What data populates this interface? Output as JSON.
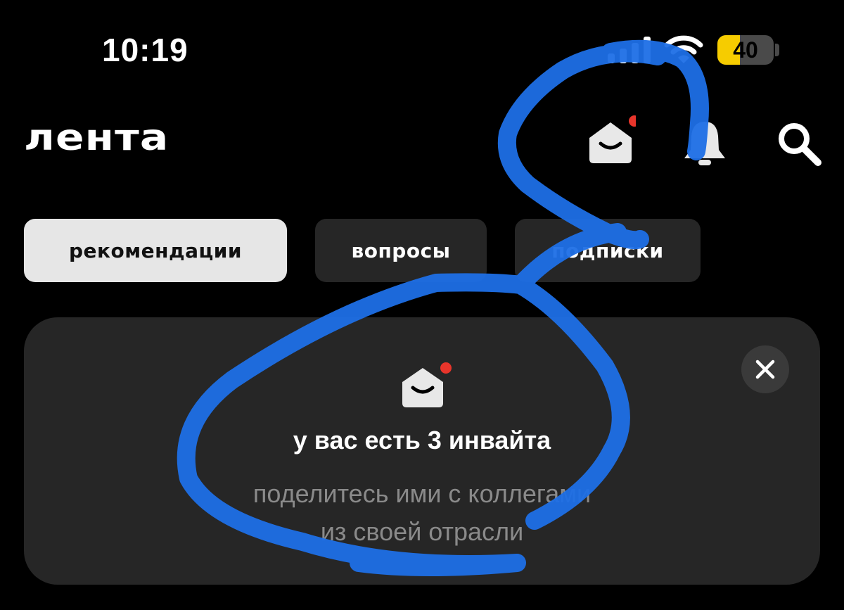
{
  "status_bar": {
    "time": "10:19",
    "signal_icon": "cellular-signal-icon",
    "wifi_icon": "wifi-icon",
    "battery_percent": 40,
    "battery_label": "40",
    "battery_color": "#f6cc00"
  },
  "header": {
    "title": "лента",
    "icons": [
      "envelope-open-icon",
      "bell-icon",
      "search-icon"
    ],
    "notification_dot_color": "#e8352b"
  },
  "tabs": [
    {
      "label": "рекомендации",
      "active": true
    },
    {
      "label": "вопросы",
      "active": false
    },
    {
      "label": "подписки",
      "active": false
    }
  ],
  "invite_card": {
    "icon": "envelope-open-icon",
    "title": "у вас есть 3 инвайта",
    "subtitle_line1": "поделитесь ими с коллегами",
    "subtitle_line2": "из своей отрасли",
    "close_icon": "close-icon"
  },
  "annotation": {
    "color": "#1e6fe6"
  }
}
